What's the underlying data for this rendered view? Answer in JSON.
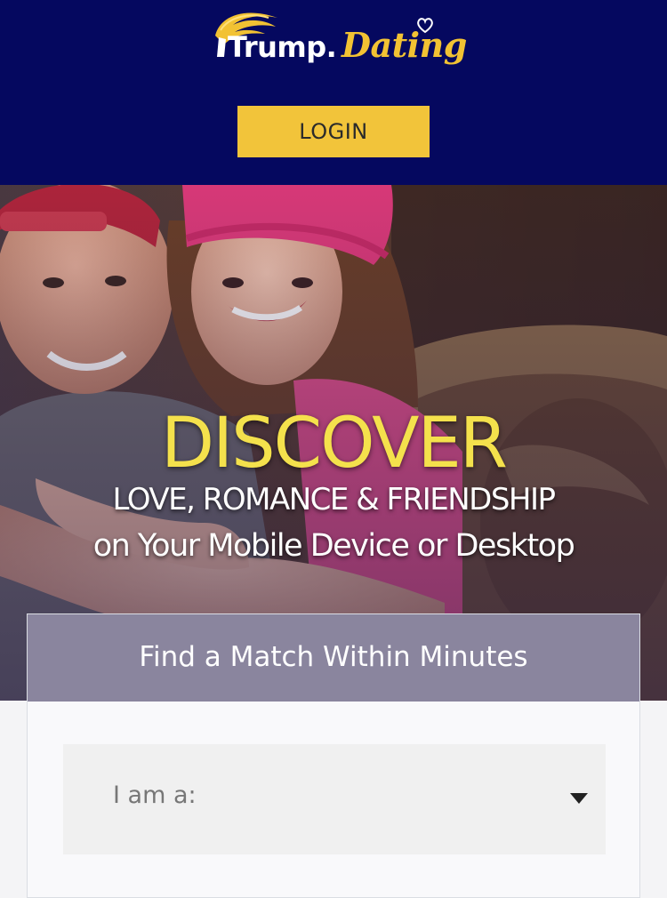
{
  "header": {
    "logo": {
      "brand": "Trump.",
      "script": "Dating"
    },
    "login_label": "LOGIN",
    "background_color": "#05085f",
    "accent_color": "#f2c43a"
  },
  "hero": {
    "headline": "DISCOVER",
    "subline1": "LOVE, ROMANCE & FRIENDSHIP",
    "subline2": "on Your Mobile Device or Desktop",
    "photo_description_icon": "couple-photo"
  },
  "form": {
    "title": "Find a Match Within Minutes",
    "gender_select": {
      "placeholder": "I am a:",
      "icon": "caret-down-icon"
    }
  }
}
